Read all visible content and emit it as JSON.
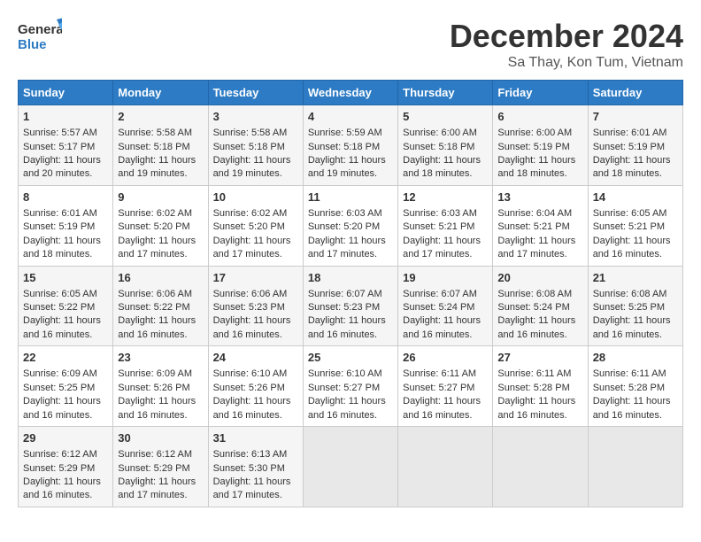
{
  "header": {
    "logo_line1": "General",
    "logo_line2": "Blue",
    "title": "December 2024",
    "subtitle": "Sa Thay, Kon Tum, Vietnam"
  },
  "days_of_week": [
    "Sunday",
    "Monday",
    "Tuesday",
    "Wednesday",
    "Thursday",
    "Friday",
    "Saturday"
  ],
  "weeks": [
    [
      {
        "day": "1",
        "info": "Sunrise: 5:57 AM\nSunset: 5:17 PM\nDaylight: 11 hours\nand 20 minutes."
      },
      {
        "day": "2",
        "info": "Sunrise: 5:58 AM\nSunset: 5:18 PM\nDaylight: 11 hours\nand 19 minutes."
      },
      {
        "day": "3",
        "info": "Sunrise: 5:58 AM\nSunset: 5:18 PM\nDaylight: 11 hours\nand 19 minutes."
      },
      {
        "day": "4",
        "info": "Sunrise: 5:59 AM\nSunset: 5:18 PM\nDaylight: 11 hours\nand 19 minutes."
      },
      {
        "day": "5",
        "info": "Sunrise: 6:00 AM\nSunset: 5:18 PM\nDaylight: 11 hours\nand 18 minutes."
      },
      {
        "day": "6",
        "info": "Sunrise: 6:00 AM\nSunset: 5:19 PM\nDaylight: 11 hours\nand 18 minutes."
      },
      {
        "day": "7",
        "info": "Sunrise: 6:01 AM\nSunset: 5:19 PM\nDaylight: 11 hours\nand 18 minutes."
      }
    ],
    [
      {
        "day": "8",
        "info": "Sunrise: 6:01 AM\nSunset: 5:19 PM\nDaylight: 11 hours\nand 18 minutes."
      },
      {
        "day": "9",
        "info": "Sunrise: 6:02 AM\nSunset: 5:20 PM\nDaylight: 11 hours\nand 17 minutes."
      },
      {
        "day": "10",
        "info": "Sunrise: 6:02 AM\nSunset: 5:20 PM\nDaylight: 11 hours\nand 17 minutes."
      },
      {
        "day": "11",
        "info": "Sunrise: 6:03 AM\nSunset: 5:20 PM\nDaylight: 11 hours\nand 17 minutes."
      },
      {
        "day": "12",
        "info": "Sunrise: 6:03 AM\nSunset: 5:21 PM\nDaylight: 11 hours\nand 17 minutes."
      },
      {
        "day": "13",
        "info": "Sunrise: 6:04 AM\nSunset: 5:21 PM\nDaylight: 11 hours\nand 17 minutes."
      },
      {
        "day": "14",
        "info": "Sunrise: 6:05 AM\nSunset: 5:21 PM\nDaylight: 11 hours\nand 16 minutes."
      }
    ],
    [
      {
        "day": "15",
        "info": "Sunrise: 6:05 AM\nSunset: 5:22 PM\nDaylight: 11 hours\nand 16 minutes."
      },
      {
        "day": "16",
        "info": "Sunrise: 6:06 AM\nSunset: 5:22 PM\nDaylight: 11 hours\nand 16 minutes."
      },
      {
        "day": "17",
        "info": "Sunrise: 6:06 AM\nSunset: 5:23 PM\nDaylight: 11 hours\nand 16 minutes."
      },
      {
        "day": "18",
        "info": "Sunrise: 6:07 AM\nSunset: 5:23 PM\nDaylight: 11 hours\nand 16 minutes."
      },
      {
        "day": "19",
        "info": "Sunrise: 6:07 AM\nSunset: 5:24 PM\nDaylight: 11 hours\nand 16 minutes."
      },
      {
        "day": "20",
        "info": "Sunrise: 6:08 AM\nSunset: 5:24 PM\nDaylight: 11 hours\nand 16 minutes."
      },
      {
        "day": "21",
        "info": "Sunrise: 6:08 AM\nSunset: 5:25 PM\nDaylight: 11 hours\nand 16 minutes."
      }
    ],
    [
      {
        "day": "22",
        "info": "Sunrise: 6:09 AM\nSunset: 5:25 PM\nDaylight: 11 hours\nand 16 minutes."
      },
      {
        "day": "23",
        "info": "Sunrise: 6:09 AM\nSunset: 5:26 PM\nDaylight: 11 hours\nand 16 minutes."
      },
      {
        "day": "24",
        "info": "Sunrise: 6:10 AM\nSunset: 5:26 PM\nDaylight: 11 hours\nand 16 minutes."
      },
      {
        "day": "25",
        "info": "Sunrise: 6:10 AM\nSunset: 5:27 PM\nDaylight: 11 hours\nand 16 minutes."
      },
      {
        "day": "26",
        "info": "Sunrise: 6:11 AM\nSunset: 5:27 PM\nDaylight: 11 hours\nand 16 minutes."
      },
      {
        "day": "27",
        "info": "Sunrise: 6:11 AM\nSunset: 5:28 PM\nDaylight: 11 hours\nand 16 minutes."
      },
      {
        "day": "28",
        "info": "Sunrise: 6:11 AM\nSunset: 5:28 PM\nDaylight: 11 hours\nand 16 minutes."
      }
    ],
    [
      {
        "day": "29",
        "info": "Sunrise: 6:12 AM\nSunset: 5:29 PM\nDaylight: 11 hours\nand 16 minutes."
      },
      {
        "day": "30",
        "info": "Sunrise: 6:12 AM\nSunset: 5:29 PM\nDaylight: 11 hours\nand 17 minutes."
      },
      {
        "day": "31",
        "info": "Sunrise: 6:13 AM\nSunset: 5:30 PM\nDaylight: 11 hours\nand 17 minutes."
      },
      {
        "day": "",
        "info": ""
      },
      {
        "day": "",
        "info": ""
      },
      {
        "day": "",
        "info": ""
      },
      {
        "day": "",
        "info": ""
      }
    ]
  ]
}
